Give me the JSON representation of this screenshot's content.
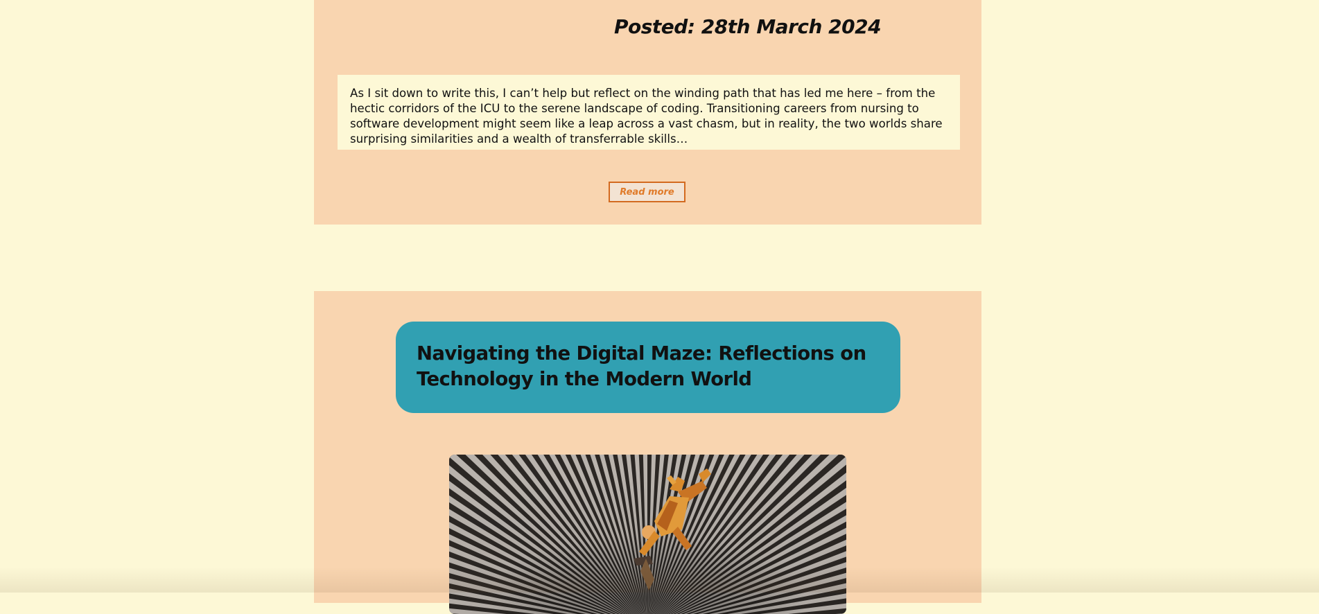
{
  "posts": [
    {
      "posted": "Posted: 28th March 2024",
      "excerpt": "As I sit down to write this, I can’t help but reflect on the winding path that has led me here – from the hectic corridors of the ICU to the serene landscape of coding. Transitioning careers from nursing to software development might seem like a leap across a vast chasm, but in reality, the two worlds share surprising similarities and a wealth of transferrable skills…",
      "read_more_label": "Read more"
    },
    {
      "title": "Navigating the Digital Maze: Reflections on Technology in the Modern World",
      "image_icon": "falling-man-illustration"
    }
  ],
  "colors": {
    "page_background": "#fdf8d6",
    "card_background": "#f9d5b0",
    "title_box": "#31a0b2",
    "read_more_border": "#d36a1f",
    "read_more_text": "#e07b2a"
  }
}
